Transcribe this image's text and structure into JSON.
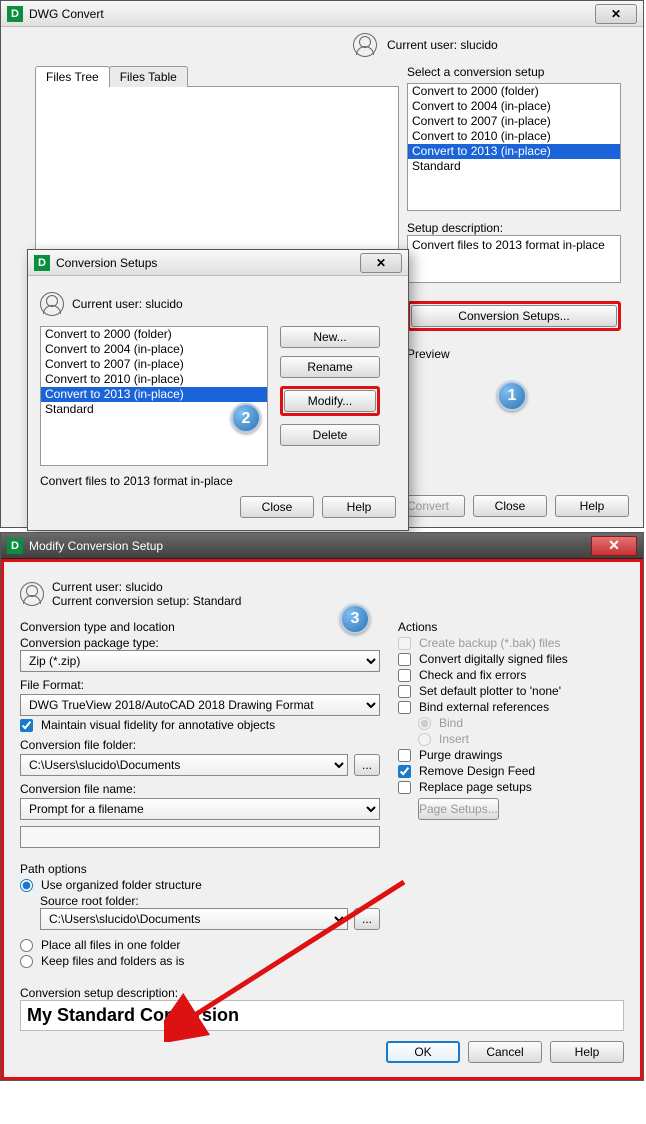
{
  "win1": {
    "title": "DWG Convert",
    "current_user_label": "Current user: slucido",
    "tabs": {
      "tree": "Files Tree",
      "table": "Files Table"
    },
    "select_setup_label": "Select a conversion setup",
    "setups": [
      "Convert to 2000 (folder)",
      "Convert to 2004 (in-place)",
      "Convert to 2007 (in-place)",
      "Convert to 2010 (in-place)",
      "Convert to 2013 (in-place)",
      "Standard"
    ],
    "setup_desc_label": "Setup description:",
    "setup_desc_value": "Convert files to 2013 format in-place",
    "conv_setups_btn": "Conversion Setups...",
    "preview_label": "Preview",
    "convert_btn": "Convert",
    "close_btn": "Close",
    "help_btn": "Help"
  },
  "win2": {
    "title": "Conversion Setups",
    "current_user_label": "Current user: slucido",
    "setups": [
      "Convert to 2000 (folder)",
      "Convert to 2004 (in-place)",
      "Convert to 2007 (in-place)",
      "Convert to 2010 (in-place)",
      "Convert to 2013 (in-place)",
      "Standard"
    ],
    "new_btn": "New...",
    "rename_btn": "Rename",
    "modify_btn": "Modify...",
    "delete_btn": "Delete",
    "desc_value": "Convert files to 2013 format in-place",
    "close_btn": "Close",
    "help_btn": "Help"
  },
  "win3": {
    "title": "Modify Conversion Setup",
    "current_user_label": "Current user: slucido",
    "current_setup_label": "Current conversion setup: Standard",
    "type_loc_legend": "Conversion type and location",
    "pkg_type_label": "Conversion package type:",
    "pkg_type_value": "Zip (*.zip)",
    "file_fmt_label": "File Format:",
    "file_fmt_value": "DWG TrueView 2018/AutoCAD 2018 Drawing Format",
    "maintain_fidelity": "Maintain visual fidelity for annotative objects",
    "conv_folder_label": "Conversion file folder:",
    "conv_folder_value": "C:\\Users\\slucido\\Documents",
    "conv_name_label": "Conversion file name:",
    "conv_name_value": "Prompt for a filename",
    "path_legend": "Path options",
    "use_org": "Use organized folder structure",
    "src_root_label": "Source root folder:",
    "src_root_value": "C:\\Users\\slucido\\Documents",
    "place_one": "Place all files in one folder",
    "keep_asis": "Keep files and folders as is",
    "actions_legend": "Actions",
    "act_backup": "Create backup (*.bak) files",
    "act_signed": "Convert digitally signed files",
    "act_checkfix": "Check and fix errors",
    "act_plotter": "Set default plotter to 'none'",
    "act_bindext": "Bind external references",
    "act_bind": "Bind",
    "act_insert": "Insert",
    "act_purge": "Purge drawings",
    "act_remove_feed": "Remove Design Feed",
    "act_replace_ps": "Replace page setups",
    "page_setups_btn": "Page Setups...",
    "desc_label": "Conversion setup description:",
    "desc_value": "My Standard Conversion",
    "ok": "OK",
    "cancel": "Cancel",
    "help": "Help"
  },
  "badges": {
    "one": "1",
    "two": "2",
    "three": "3"
  }
}
